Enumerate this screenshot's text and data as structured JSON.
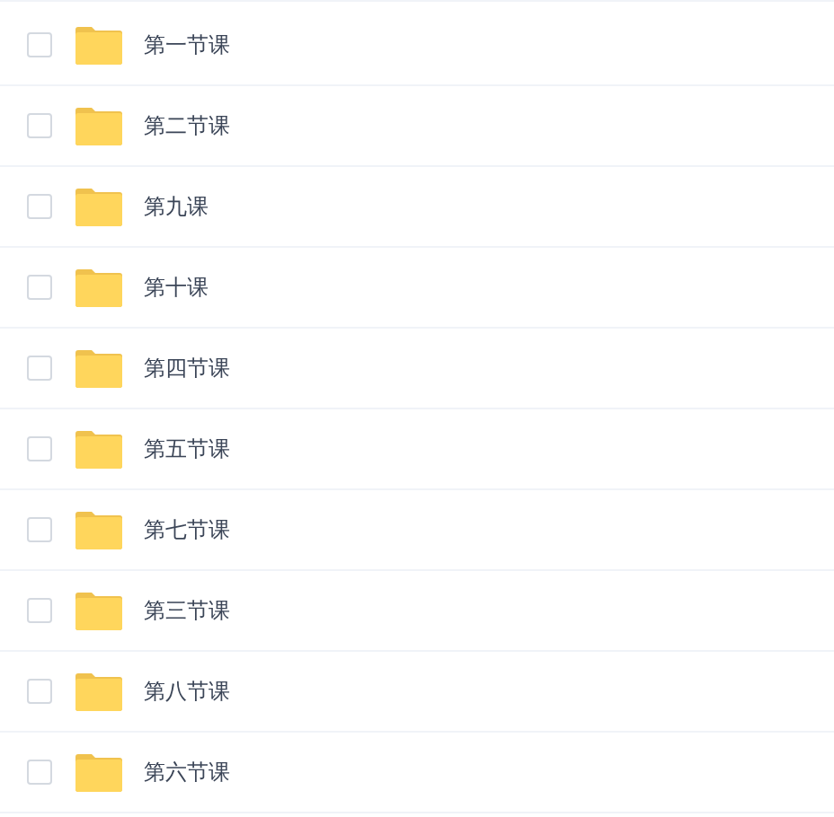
{
  "files": [
    {
      "name": "第一节课",
      "checked": false
    },
    {
      "name": "第二节课",
      "checked": false
    },
    {
      "name": "第九课",
      "checked": false
    },
    {
      "name": "第十课",
      "checked": false
    },
    {
      "name": "第四节课",
      "checked": false
    },
    {
      "name": "第五节课",
      "checked": false
    },
    {
      "name": "第七节课",
      "checked": false
    },
    {
      "name": "第三节课",
      "checked": false
    },
    {
      "name": "第八节课",
      "checked": false
    },
    {
      "name": "第六节课",
      "checked": false
    }
  ]
}
